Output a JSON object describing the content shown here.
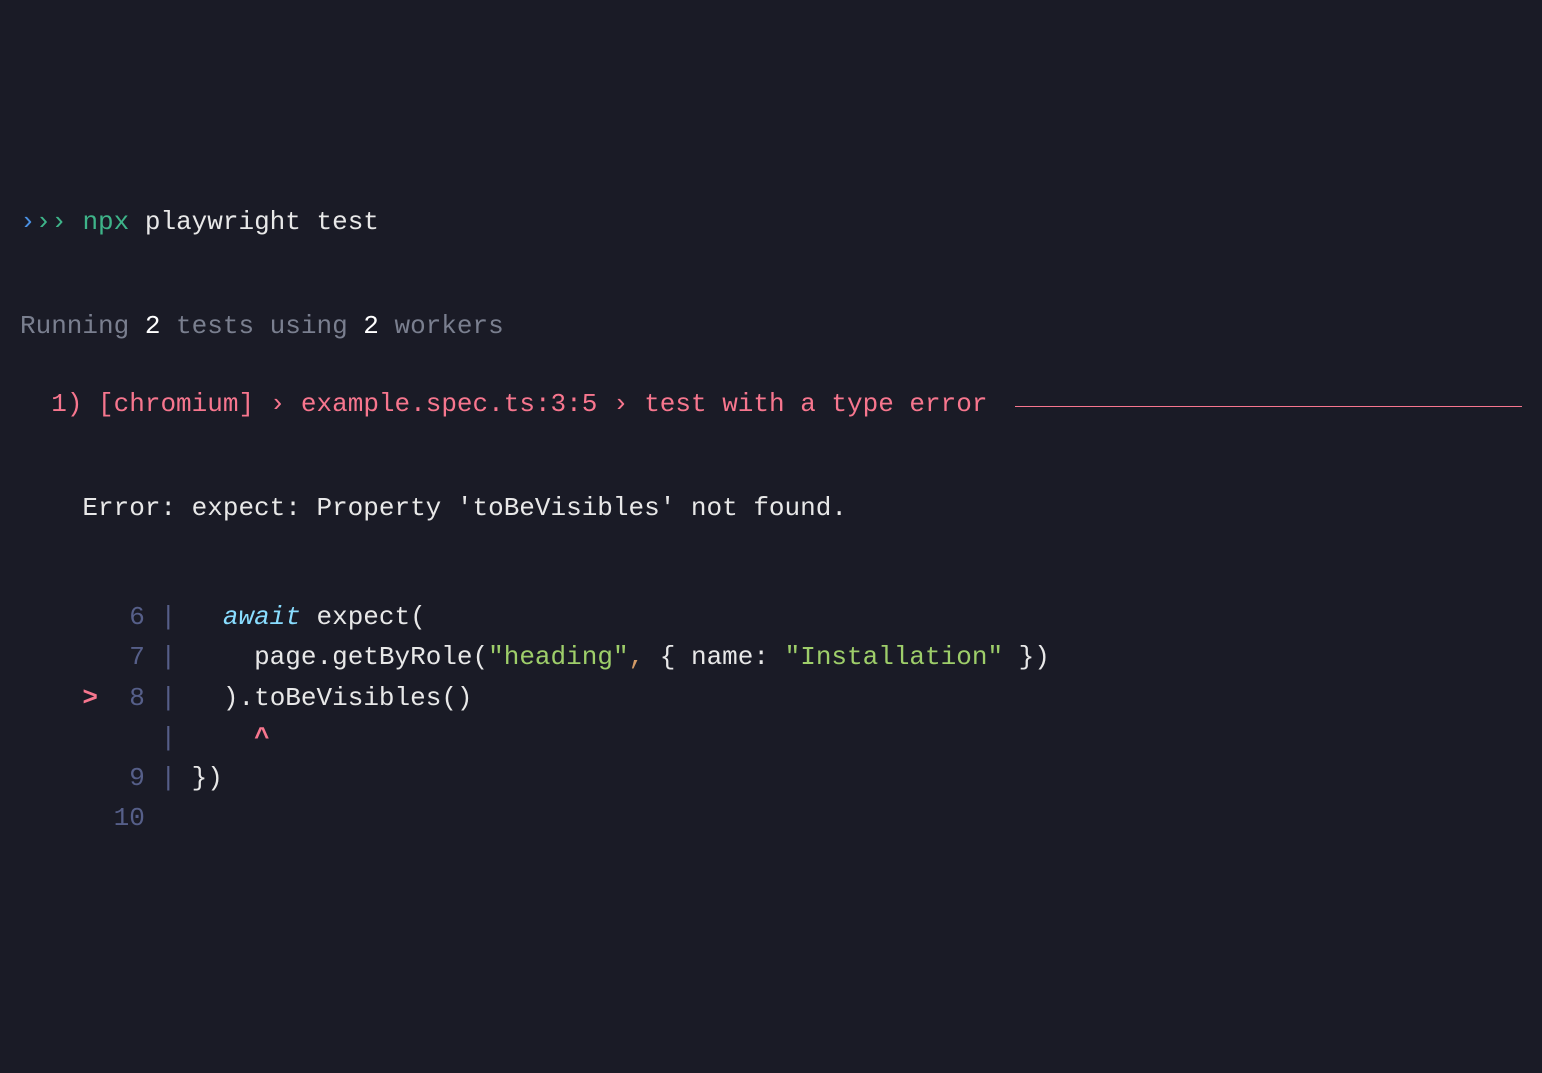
{
  "prompt": {
    "chevrons": [
      "›",
      "›",
      "›"
    ],
    "command": "npx",
    "args": "playwright test"
  },
  "status": {
    "prefix": "Running ",
    "test_count": "2",
    "mid1": " tests using ",
    "worker_count": "2",
    "suffix": " workers"
  },
  "failure": {
    "index": "1)",
    "browser": "[chromium]",
    "sep1": "›",
    "file": "example.spec.ts:3:5",
    "sep2": "›",
    "title": "test with a type error"
  },
  "error": {
    "message": "Error: expect: Property 'toBeVisibles' not found."
  },
  "code": {
    "lines": [
      {
        "marker": "  ",
        "num": " 6",
        "pipe": "|",
        "indent": "   ",
        "tokens": [
          {
            "cls": "kw-await",
            "t": "await"
          },
          {
            "cls": "fn-call",
            "t": " expect("
          }
        ]
      },
      {
        "marker": "  ",
        "num": " 7",
        "pipe": "|",
        "indent": "     ",
        "tokens": [
          {
            "cls": "fn-call",
            "t": "page.getByRole("
          },
          {
            "cls": "str",
            "t": "\"heading\""
          },
          {
            "cls": "comma",
            "t": ","
          },
          {
            "cls": "fn-call",
            "t": " { name: "
          },
          {
            "cls": "str",
            "t": "\"Installation\""
          },
          {
            "cls": "fn-call",
            "t": " })"
          }
        ]
      },
      {
        "marker": "> ",
        "num": " 8",
        "pipe": "|",
        "indent": "   ",
        "tokens": [
          {
            "cls": "fn-call",
            "t": ").toBeVisibles()"
          }
        ]
      },
      {
        "marker": "  ",
        "num": "  ",
        "pipe": "|",
        "indent": "     ",
        "tokens": [
          {
            "cls": "red-bold",
            "t": "^"
          }
        ]
      },
      {
        "marker": "  ",
        "num": " 9",
        "pipe": "|",
        "indent": " ",
        "tokens": [
          {
            "cls": "fn-call",
            "t": "})"
          }
        ]
      },
      {
        "marker": "  ",
        "num": "10",
        "pipe": "",
        "indent": "",
        "tokens": []
      }
    ]
  }
}
